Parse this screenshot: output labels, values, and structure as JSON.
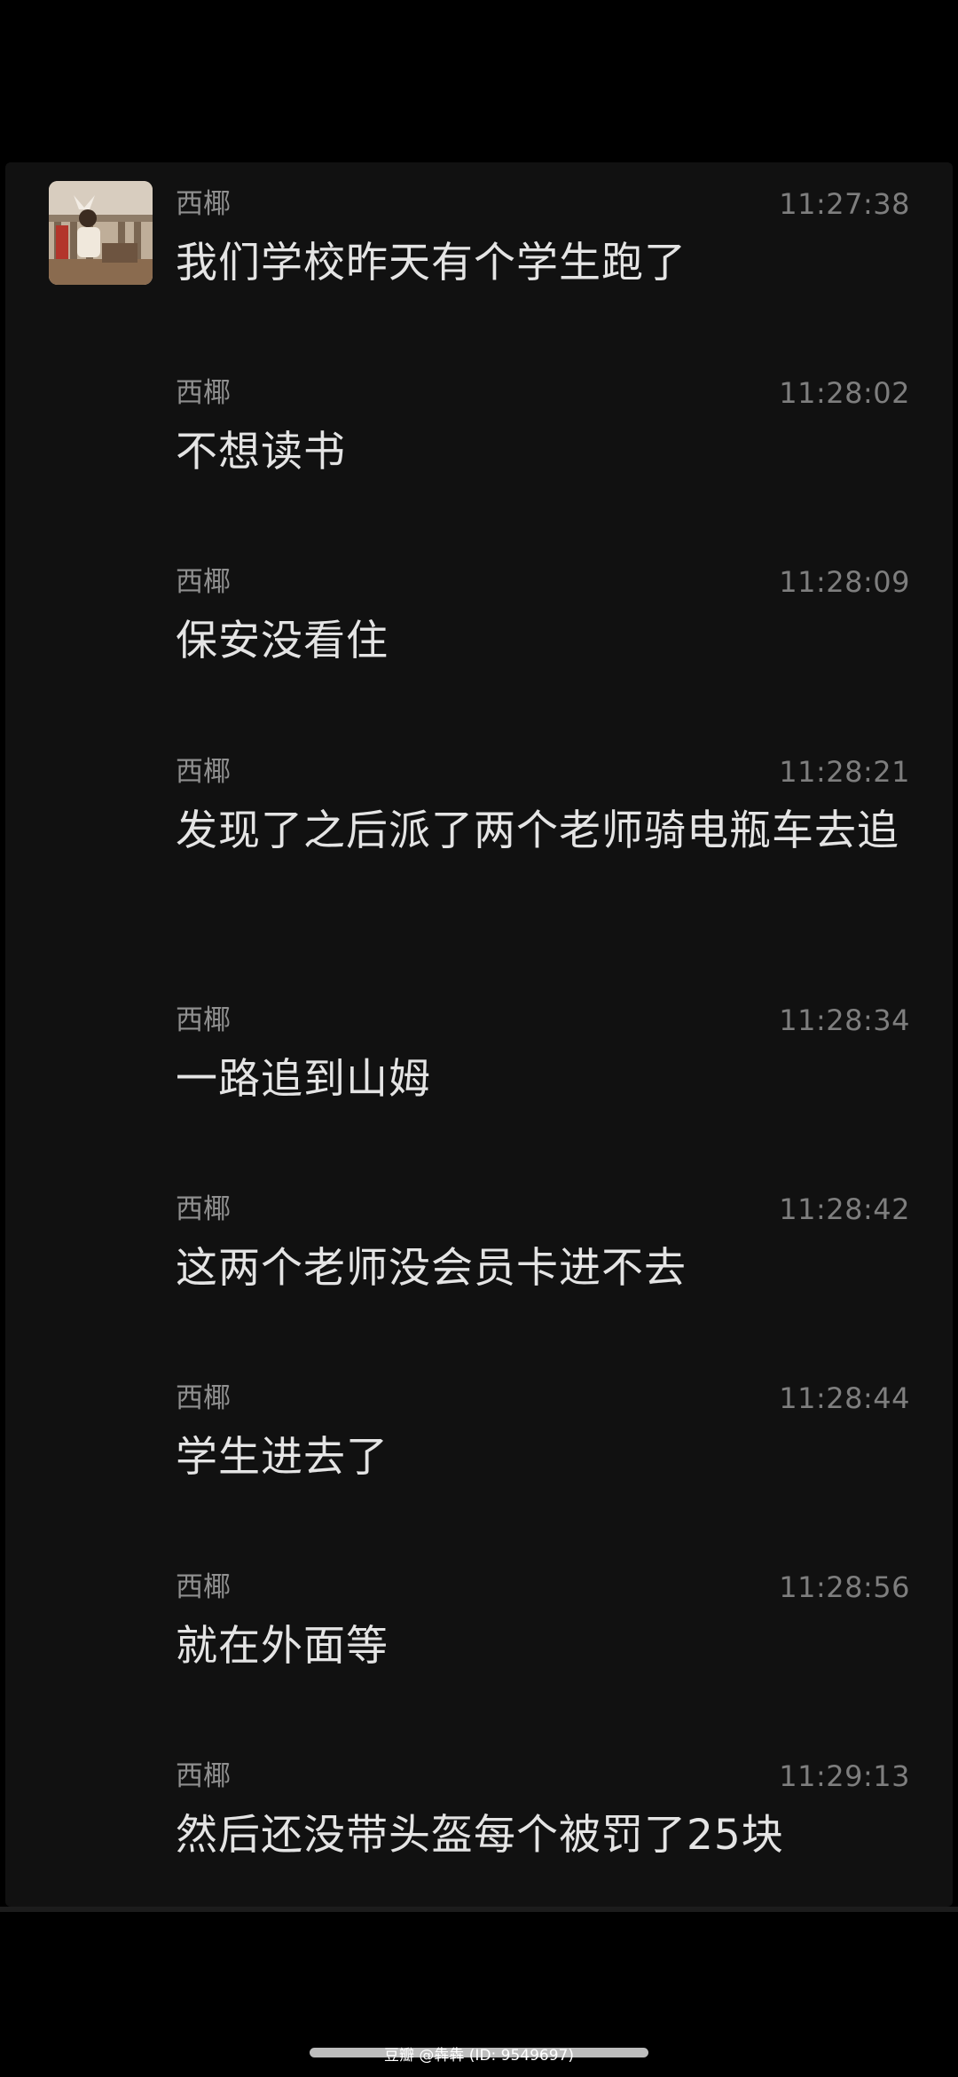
{
  "messages": [
    {
      "sender": "西椰",
      "time": "11:27:38",
      "text": "我们学校昨天有个学生跑了"
    },
    {
      "sender": "西椰",
      "time": "11:28:02",
      "text": "不想读书"
    },
    {
      "sender": "西椰",
      "time": "11:28:09",
      "text": "保安没看住"
    },
    {
      "sender": "西椰",
      "time": "11:28:21",
      "text": "发现了之后派了两个老师骑电瓶车去追"
    },
    {
      "sender": "西椰",
      "time": "11:28:34",
      "text": "一路追到山姆"
    },
    {
      "sender": "西椰",
      "time": "11:28:42",
      "text": "这两个老师没会员卡进不去"
    },
    {
      "sender": "西椰",
      "time": "11:28:44",
      "text": "学生进去了"
    },
    {
      "sender": "西椰",
      "time": "11:28:56",
      "text": "就在外面等"
    },
    {
      "sender": "西椰",
      "time": "11:29:13",
      "text": "然后还没带头盔每个被罚了25块"
    }
  ],
  "watermark": "豆瓣 @犇犇 (ID: 9549697)"
}
